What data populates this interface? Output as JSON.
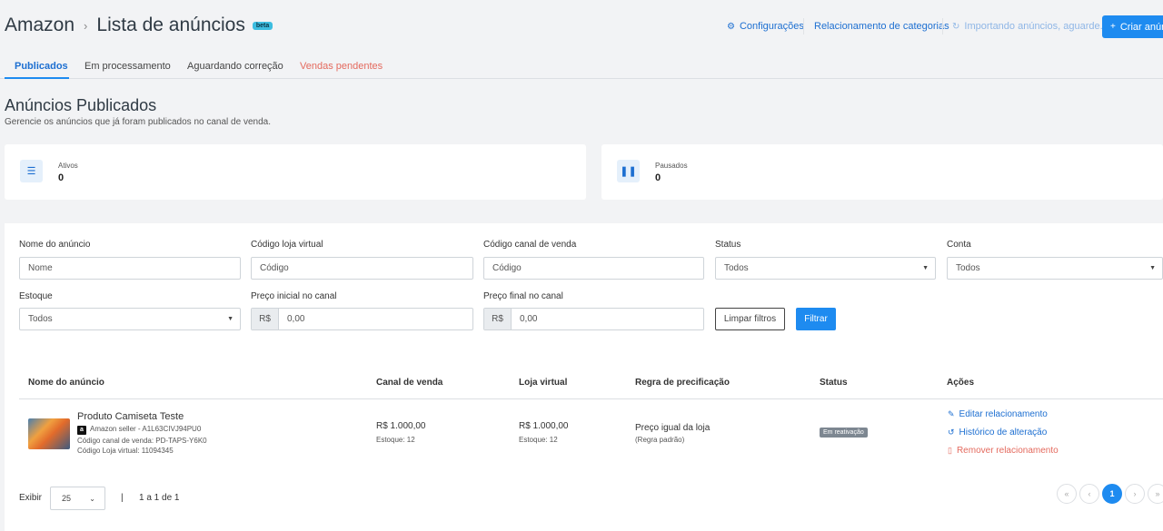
{
  "header": {
    "app": "Amazon",
    "title": "Lista de anúncios",
    "badge": "beta",
    "links": {
      "config": "Configurações",
      "categories": "Relacionamento de categorias",
      "importing": "Importando anúncios, aguarde..."
    },
    "create_button": "Criar anún"
  },
  "tabs": [
    "Publicados",
    "Em processamento",
    "Aguardando correção",
    "Vendas pendentes"
  ],
  "section": {
    "title": "Anúncios Publicados",
    "subtitle": "Gerencie os anúncios que já foram publicados no canal de venda."
  },
  "cards": [
    {
      "label": "Ativos",
      "value": "0",
      "icon": "list-icon"
    },
    {
      "label": "Pausados",
      "value": "0",
      "icon": "pause-icon"
    }
  ],
  "filters": {
    "name": {
      "label": "Nome do anúncio",
      "placeholder": "Nome"
    },
    "store_code": {
      "label": "Código loja virtual",
      "placeholder": "Código"
    },
    "channel_code": {
      "label": "Código canal de venda",
      "placeholder": "Código"
    },
    "status": {
      "label": "Status",
      "value": "Todos"
    },
    "account": {
      "label": "Conta",
      "value": "Todos"
    },
    "stock": {
      "label": "Estoque",
      "value": "Todos"
    },
    "price_min": {
      "label": "Preço inicial no canal",
      "prefix": "R$",
      "value": "0,00"
    },
    "price_max": {
      "label": "Preço final no canal",
      "prefix": "R$",
      "value": "0,00"
    },
    "clear": "Limpar filtros",
    "apply": "Filtrar"
  },
  "table": {
    "headers": [
      "Nome do anúncio",
      "Canal de venda",
      "Loja virtual",
      "Regra de precificação",
      "Status",
      "Ações"
    ],
    "row": {
      "name": "Produto Camiseta Teste",
      "seller": "Amazon seller - A1L63CIVJ94PU0",
      "seller_badge": "a",
      "channel_code": "Código canal de venda: PD-TAPS-Y6K0",
      "store_code": "Código Loja virtual: 11094345",
      "channel_price": "R$ 1.000,00",
      "channel_stock": "Estoque: 12",
      "store_price": "R$ 1.000,00",
      "store_stock": "Estoque: 12",
      "rule": "Preço igual da loja",
      "rule_sub": "(Regra padrão)",
      "status": "Em reativação",
      "actions": [
        "Editar relacionamento",
        "Histórico de alteração",
        "Remover relacionamento"
      ]
    }
  },
  "footer": {
    "show_label": "Exibir",
    "page_size": "25",
    "divider": "|",
    "range": "1 a 1 de 1",
    "pages": [
      "«",
      "‹",
      "1",
      "›",
      "»"
    ]
  }
}
